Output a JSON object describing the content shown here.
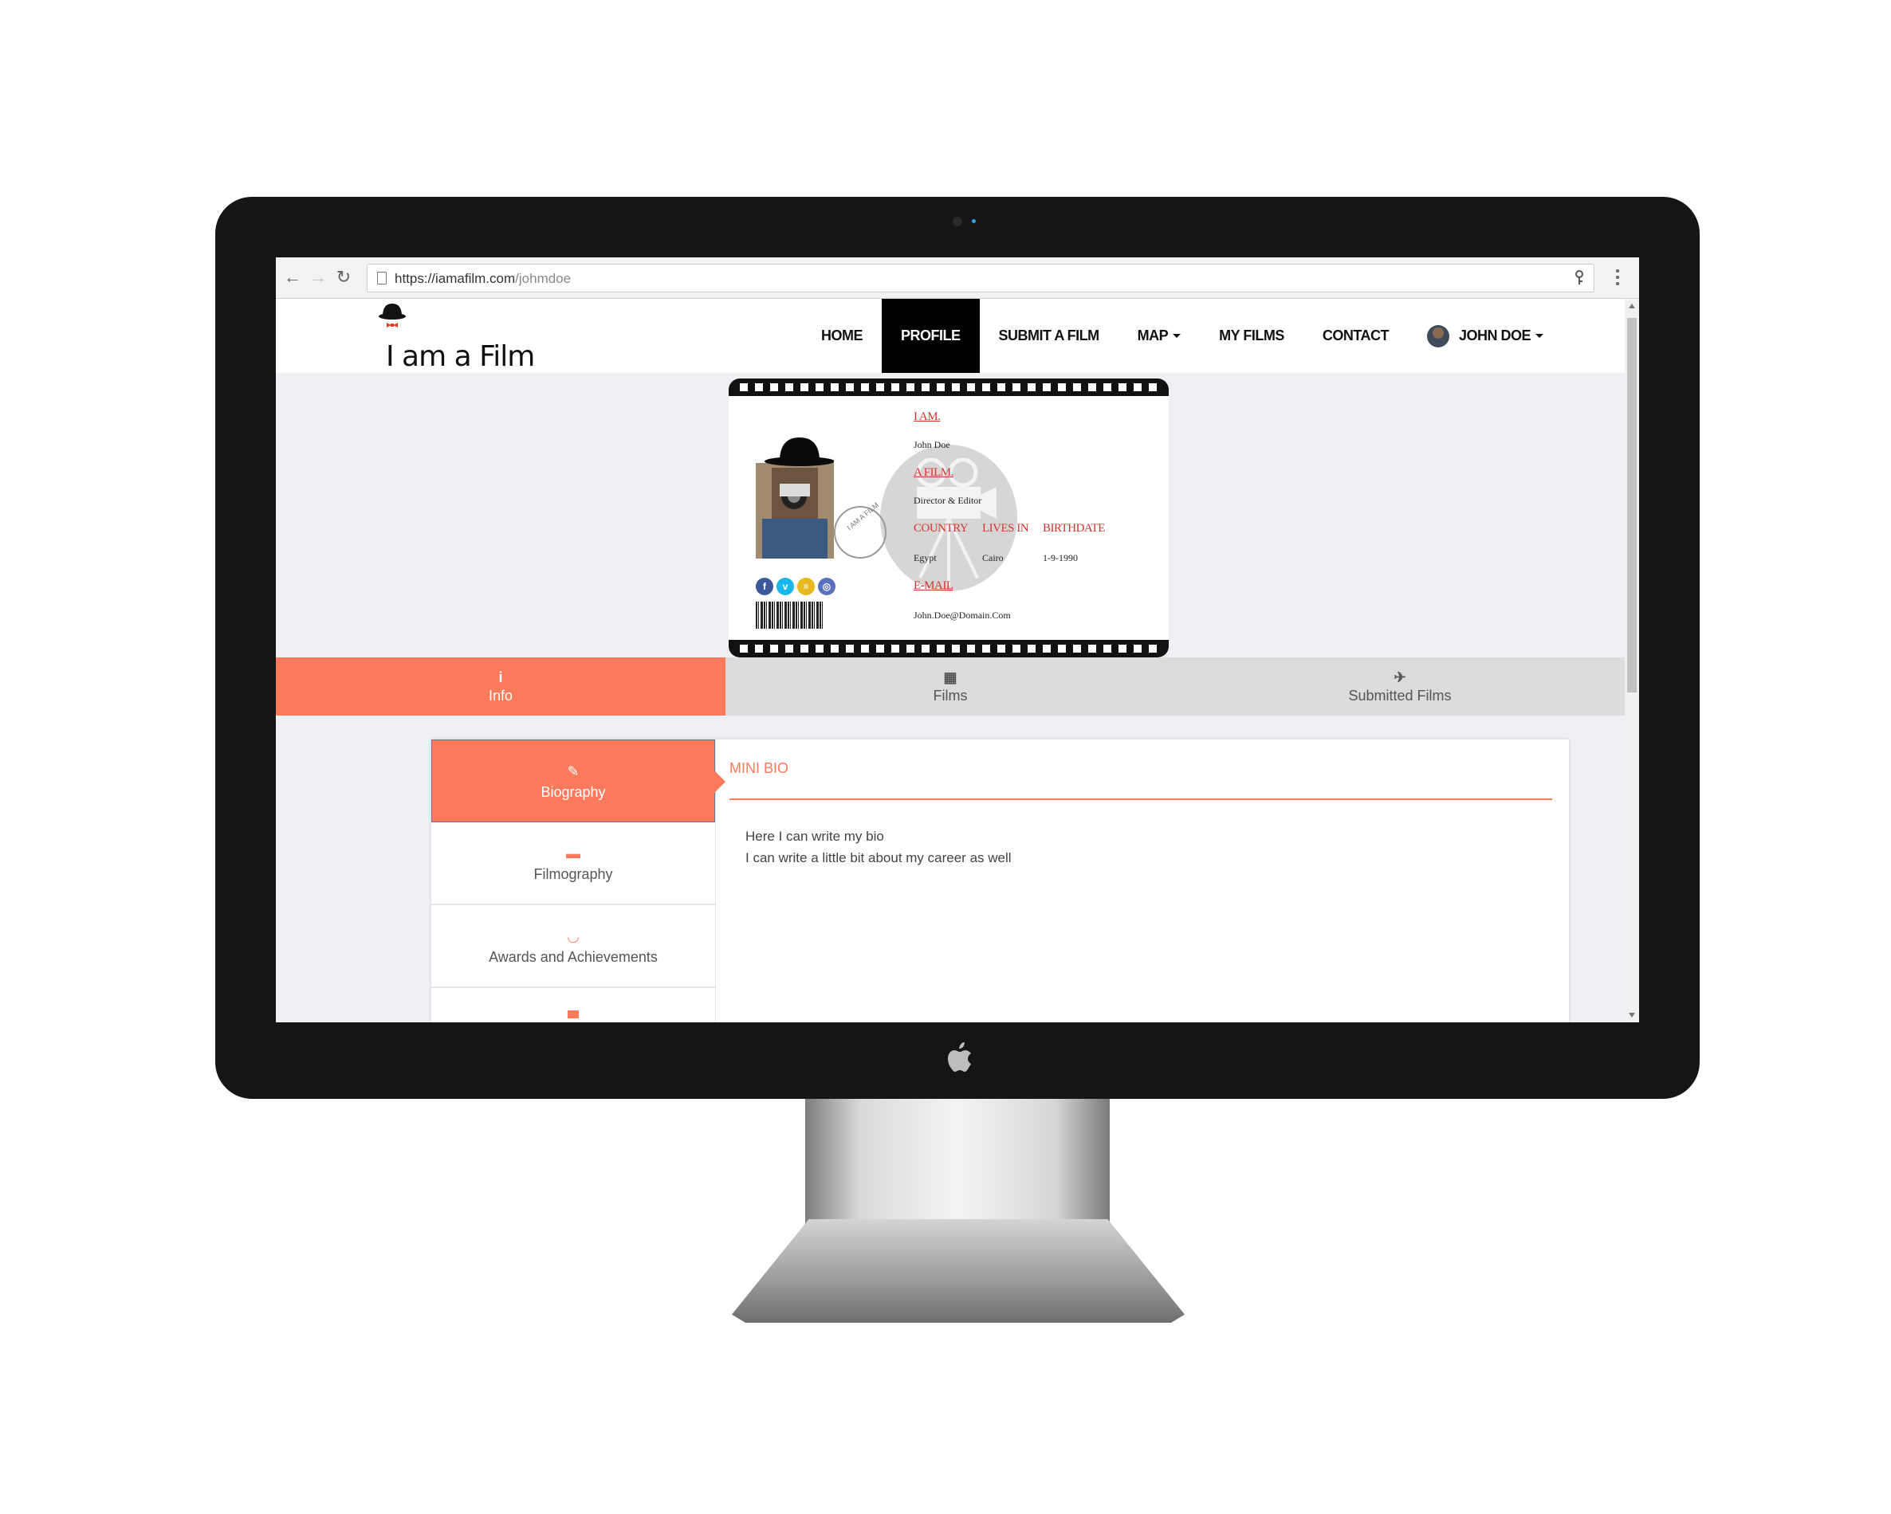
{
  "browser": {
    "url_host": "https://iamafilm.com",
    "url_path": "/johmdoe"
  },
  "site": {
    "logo_text": "I am a Film"
  },
  "nav": {
    "items": [
      {
        "label": "HOME",
        "active": false,
        "caret": false
      },
      {
        "label": "PROFILE",
        "active": true,
        "caret": false
      },
      {
        "label": "SUBMIT A FILM",
        "active": false,
        "caret": false
      },
      {
        "label": "MAP",
        "active": false,
        "caret": true
      },
      {
        "label": "MY FILMS",
        "active": false,
        "caret": false
      },
      {
        "label": "CONTACT",
        "active": false,
        "caret": false
      }
    ],
    "user_label": "JOHN DOE"
  },
  "id_card": {
    "iam_label": "I AM.",
    "name": "John Doe",
    "afilm_label": "A FILM.",
    "role": "Director & Editor",
    "country_label": "COUNTRY",
    "country": "Egypt",
    "lives_label": "LIVES IN",
    "lives": "Cairo",
    "birth_label": "BIRTHDATE",
    "birth": "1-9-1990",
    "email_label": "E-MAIL",
    "email": "John.Doe@Domain.Com",
    "stamp_text": "I AM A FILM",
    "socials": [
      {
        "name": "facebook-icon",
        "glyph": "f",
        "color": "#3b5998"
      },
      {
        "name": "vimeo-icon",
        "glyph": "v",
        "color": "#1ab7ea"
      },
      {
        "name": "imdb-icon",
        "glyph": "≡",
        "color": "#e6b91e"
      },
      {
        "name": "instagram-icon",
        "glyph": "◎",
        "color": "#5b6fbf"
      }
    ]
  },
  "main_tabs": [
    {
      "label": "Info",
      "icon": "info-icon",
      "glyph": "i",
      "active": true
    },
    {
      "label": "Films",
      "icon": "film-icon",
      "glyph": "▦",
      "active": false
    },
    {
      "label": "Submitted Films",
      "icon": "plane-icon",
      "glyph": "✈",
      "active": false
    }
  ],
  "side_tabs": [
    {
      "label": "Biography",
      "icon": "edit-icon",
      "glyph": "✎",
      "active": true
    },
    {
      "label": "Filmography",
      "icon": "briefcase-icon",
      "glyph": "▬",
      "active": false
    },
    {
      "label": "Awards and Achievements",
      "icon": "laurel-icon",
      "glyph": "◡",
      "active": false
    }
  ],
  "mini_bio": {
    "title": "MINI BIO",
    "line1": "Here I can write my bio",
    "line2": "I can write a little bit about my career as well"
  },
  "colors": {
    "accent": "#fc7a5c",
    "card_label": "#d5342d",
    "page_bg": "#eff0f4",
    "tab_bar": "#dcdcdc"
  }
}
